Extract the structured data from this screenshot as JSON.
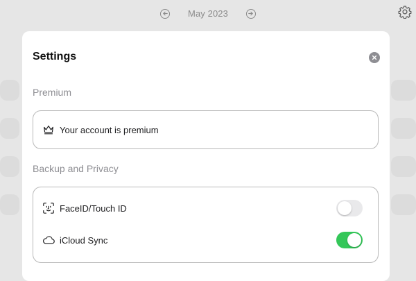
{
  "header": {
    "month": "May 2023",
    "prev_icon": "arrow-left-circle-icon",
    "next_icon": "arrow-right-circle-icon",
    "settings_icon": "gear-icon"
  },
  "modal": {
    "title": "Settings",
    "close_icon": "close-icon",
    "sections": [
      {
        "header": "Premium",
        "rows": [
          {
            "icon": "crown-icon",
            "label": "Your account is premium"
          }
        ]
      },
      {
        "header": "Backup and Privacy",
        "rows": [
          {
            "icon": "faceid-icon",
            "label": "FaceID/Touch ID",
            "toggle": false
          },
          {
            "icon": "cloud-icon",
            "label": "iCloud Sync",
            "toggle": true
          }
        ]
      }
    ]
  },
  "colors": {
    "toggle_on": "#34c759",
    "toggle_off": "#e9e9eb",
    "backdrop": "#e6e6e6"
  }
}
